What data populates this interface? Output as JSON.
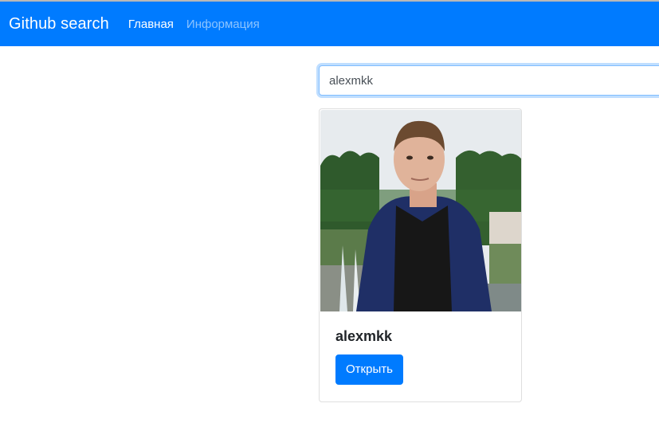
{
  "navbar": {
    "brand": "Github search",
    "links": [
      {
        "label": "Главная",
        "state": "active"
      },
      {
        "label": "Информация",
        "state": "muted"
      }
    ],
    "background": "#007bff"
  },
  "search": {
    "value": "alexmkk",
    "placeholder": ""
  },
  "result_card": {
    "username": "alexmkk",
    "button_label": "Открыть",
    "avatar_icon": "user-avatar-photo"
  },
  "colors": {
    "primary": "#007bff",
    "text": "#212529"
  }
}
